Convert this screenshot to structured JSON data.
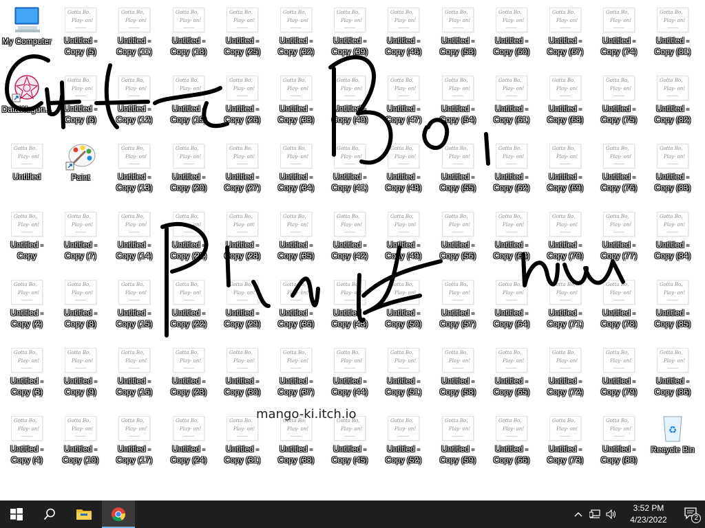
{
  "desktop": {
    "columns": [
      [
        {
          "label": "My Computer",
          "type": "computer"
        },
        {
          "label": "DataWagon...",
          "type": "datawagon"
        },
        {
          "label": "Untitled",
          "type": "doc"
        },
        {
          "label": "Untitled - Copy",
          "type": "doc"
        },
        {
          "label": "Untitled - Copy (2)",
          "type": "doc"
        },
        {
          "label": "Untitled - Copy (3)",
          "type": "doc"
        },
        {
          "label": "Untitled - Copy (4)",
          "type": "doc"
        }
      ],
      [
        {
          "label": "Untitled - Copy (5)",
          "type": "doc"
        },
        {
          "label": "Untitled - Copy (6)",
          "type": "doc"
        },
        {
          "label": "Paint",
          "type": "paint"
        },
        {
          "label": "Untitled - Copy (7)",
          "type": "doc"
        },
        {
          "label": "Untitled - Copy (8)",
          "type": "doc"
        },
        {
          "label": "Untitled - Copy (9)",
          "type": "doc"
        },
        {
          "label": "Untitled - Copy (10)",
          "type": "doc"
        }
      ],
      [
        {
          "label": "Untitled - Copy (11)",
          "type": "doc"
        },
        {
          "label": "Untitled - Copy (12)",
          "type": "doc"
        },
        {
          "label": "Untitled - Copy (13)",
          "type": "doc"
        },
        {
          "label": "Untitled - Copy (14)",
          "type": "doc"
        },
        {
          "label": "Untitled - Copy (15)",
          "type": "doc"
        },
        {
          "label": "Untitled - Copy (16)",
          "type": "doc"
        },
        {
          "label": "Untitled - Copy (17)",
          "type": "doc"
        }
      ],
      [
        {
          "label": "Untitled - Copy (18)",
          "type": "doc"
        },
        {
          "label": "Untitled - Copy (19)",
          "type": "doc"
        },
        {
          "label": "Untitled - Copy (20)",
          "type": "doc"
        },
        {
          "label": "Untitled - Copy (21)",
          "type": "doc"
        },
        {
          "label": "Untitled - Copy (22)",
          "type": "doc"
        },
        {
          "label": "Untitled - Copy (23)",
          "type": "doc"
        },
        {
          "label": "Untitled - Copy (24)",
          "type": "doc"
        }
      ],
      [
        {
          "label": "Untitled - Copy (25)",
          "type": "doc"
        },
        {
          "label": "Untitled - Copy (26)",
          "type": "doc"
        },
        {
          "label": "Untitled - Copy (27)",
          "type": "doc"
        },
        {
          "label": "Untitled - Copy (28)",
          "type": "doc"
        },
        {
          "label": "Untitled - Copy (29)",
          "type": "doc"
        },
        {
          "label": "Untitled - Copy (30)",
          "type": "doc"
        },
        {
          "label": "Untitled - Copy (31)",
          "type": "doc"
        }
      ],
      [
        {
          "label": "Untitled - Copy (32)",
          "type": "doc"
        },
        {
          "label": "Untitled - Copy (33)",
          "type": "doc"
        },
        {
          "label": "Untitled - Copy (34)",
          "type": "doc"
        },
        {
          "label": "Untitled - Copy (35)",
          "type": "doc"
        },
        {
          "label": "Untitled - Copy (36)",
          "type": "doc"
        },
        {
          "label": "Untitled - Copy (37)",
          "type": "doc"
        },
        {
          "label": "Untitled - Copy (38)",
          "type": "doc"
        }
      ],
      [
        {
          "label": "Untitled - Copy (39)",
          "type": "doc"
        },
        {
          "label": "Untitled - Copy (40)",
          "type": "doc"
        },
        {
          "label": "Untitled - Copy (41)",
          "type": "doc"
        },
        {
          "label": "Untitled - Copy (42)",
          "type": "doc"
        },
        {
          "label": "Untitled - Copy (43)",
          "type": "doc"
        },
        {
          "label": "Untitled - Copy (44)",
          "type": "doc"
        },
        {
          "label": "Untitled - Copy (45)",
          "type": "doc"
        }
      ],
      [
        {
          "label": "Untitled - Copy (46)",
          "type": "doc"
        },
        {
          "label": "Untitled - Copy (47)",
          "type": "doc"
        },
        {
          "label": "Untitled - Copy (48)",
          "type": "doc"
        },
        {
          "label": "Untitled - Copy (49)",
          "type": "doc"
        },
        {
          "label": "Untitled - Copy (50)",
          "type": "doc"
        },
        {
          "label": "Untitled - Copy (51)",
          "type": "doc"
        },
        {
          "label": "Untitled - Copy (52)",
          "type": "doc"
        }
      ],
      [
        {
          "label": "Untitled - Copy (53)",
          "type": "doc"
        },
        {
          "label": "Untitled - Copy (54)",
          "type": "doc"
        },
        {
          "label": "Untitled - Copy (55)",
          "type": "doc"
        },
        {
          "label": "Untitled - Copy (56)",
          "type": "doc"
        },
        {
          "label": "Untitled - Copy (57)",
          "type": "doc"
        },
        {
          "label": "Untitled - Copy (58)",
          "type": "doc"
        },
        {
          "label": "Untitled - Copy (59)",
          "type": "doc"
        }
      ],
      [
        {
          "label": "Untitled - Copy (60)",
          "type": "doc"
        },
        {
          "label": "Untitled - Copy (61)",
          "type": "doc"
        },
        {
          "label": "Untitled - Copy (62)",
          "type": "doc"
        },
        {
          "label": "Untitled - Copy (63)",
          "type": "doc"
        },
        {
          "label": "Untitled - Copy (64)",
          "type": "doc"
        },
        {
          "label": "Untitled - Copy (65)",
          "type": "doc"
        },
        {
          "label": "Untitled - Copy (66)",
          "type": "doc"
        }
      ],
      [
        {
          "label": "Untitled - Copy (67)",
          "type": "doc"
        },
        {
          "label": "Untitled - Copy (68)",
          "type": "doc"
        },
        {
          "label": "Untitled - Copy (69)",
          "type": "doc"
        },
        {
          "label": "Untitled - Copy (70)",
          "type": "doc"
        },
        {
          "label": "Untitled - Copy (71)",
          "type": "doc"
        },
        {
          "label": "Untitled - Copy (72)",
          "type": "doc"
        },
        {
          "label": "Untitled - Copy (73)",
          "type": "doc"
        }
      ],
      [
        {
          "label": "Untitled - Copy (74)",
          "type": "doc"
        },
        {
          "label": "Untitled - Copy (75)",
          "type": "doc"
        },
        {
          "label": "Untitled - Copy (76)",
          "type": "doc"
        },
        {
          "label": "Untitled - Copy (77)",
          "type": "doc"
        },
        {
          "label": "Untitled - Copy (78)",
          "type": "doc"
        },
        {
          "label": "Untitled - Copy (79)",
          "type": "doc"
        },
        {
          "label": "Untitled - Copy (80)",
          "type": "doc"
        }
      ],
      [
        {
          "label": "Untitled - Copy (81)",
          "type": "doc"
        },
        {
          "label": "Untitled - Copy (82)",
          "type": "doc"
        },
        {
          "label": "Untitled - Copy (83)",
          "type": "doc"
        },
        {
          "label": "Untitled - Copy (84)",
          "type": "doc"
        },
        {
          "label": "Untitled - Copy (85)",
          "type": "doc"
        },
        {
          "label": "Untitled - Copy (86)",
          "type": "doc"
        },
        {
          "label": "Recycle Bin",
          "type": "recycle"
        }
      ]
    ],
    "thumbnail_text": {
      "line1": "Gotta Bo,",
      "line2": "Play- on!"
    },
    "watermark": "mango-ki.itch.io",
    "overlay_icon": "handwritten-scribble"
  },
  "taskbar": {
    "background": "#1f1f1f",
    "accent": "#76b9ed",
    "items": [
      {
        "name": "start-button",
        "icon": "windows-logo-icon"
      },
      {
        "name": "search-button",
        "icon": "search-icon"
      },
      {
        "name": "file-explorer-button",
        "icon": "folder-icon"
      },
      {
        "name": "chrome-button",
        "icon": "chrome-icon",
        "active": true
      }
    ],
    "tray": {
      "time": "3:52 PM",
      "date": "4/23/2022",
      "notification_count": "2"
    }
  }
}
